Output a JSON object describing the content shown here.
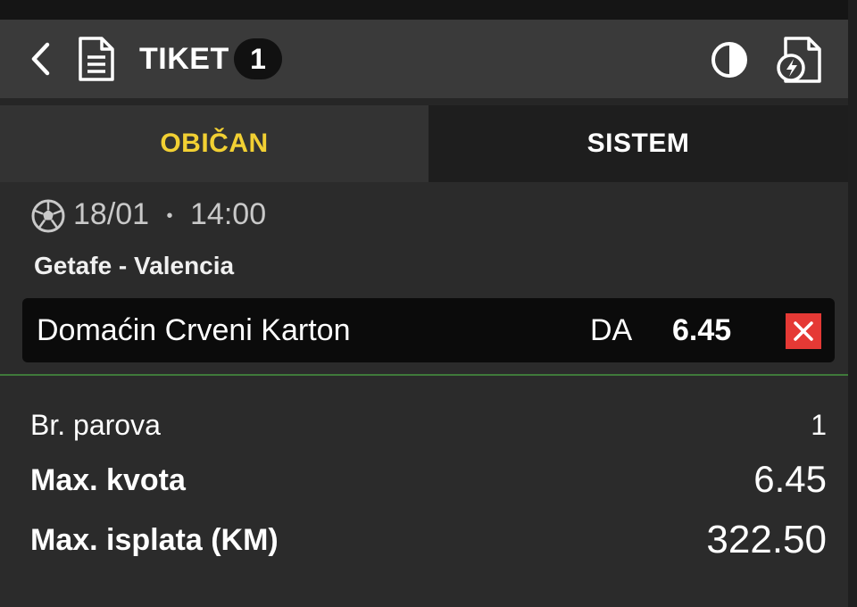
{
  "header": {
    "title": "TIKET",
    "count": "1",
    "icons": {
      "back": "chevron-left-icon",
      "ticket": "document-icon",
      "theme": "contrast-icon",
      "quick": "quick-ticket-icon"
    }
  },
  "tabs": [
    {
      "label": "OBIČAN",
      "active": true
    },
    {
      "label": "SISTEM",
      "active": false
    }
  ],
  "event": {
    "sport_icon": "soccer-ball-icon",
    "date": "18/01",
    "separator": "•",
    "time": "14:00",
    "match": "Getafe - Valencia"
  },
  "selection": {
    "market": "Domaćin Crveni Karton",
    "pick": "DA",
    "odd": "6.45",
    "remove_icon": "close-icon"
  },
  "summary": {
    "pairs_label": "Br. parova",
    "pairs_value": "1",
    "max_odds_label": "Max. kvota",
    "max_odds_value": "6.45",
    "max_payout_label": "Max. isplata (KM)",
    "max_payout_value": "322.50"
  },
  "colors": {
    "accent": "#f2d033",
    "remove": "#e53935",
    "divider": "#3f7a3a",
    "background": "#2b2b2b"
  }
}
